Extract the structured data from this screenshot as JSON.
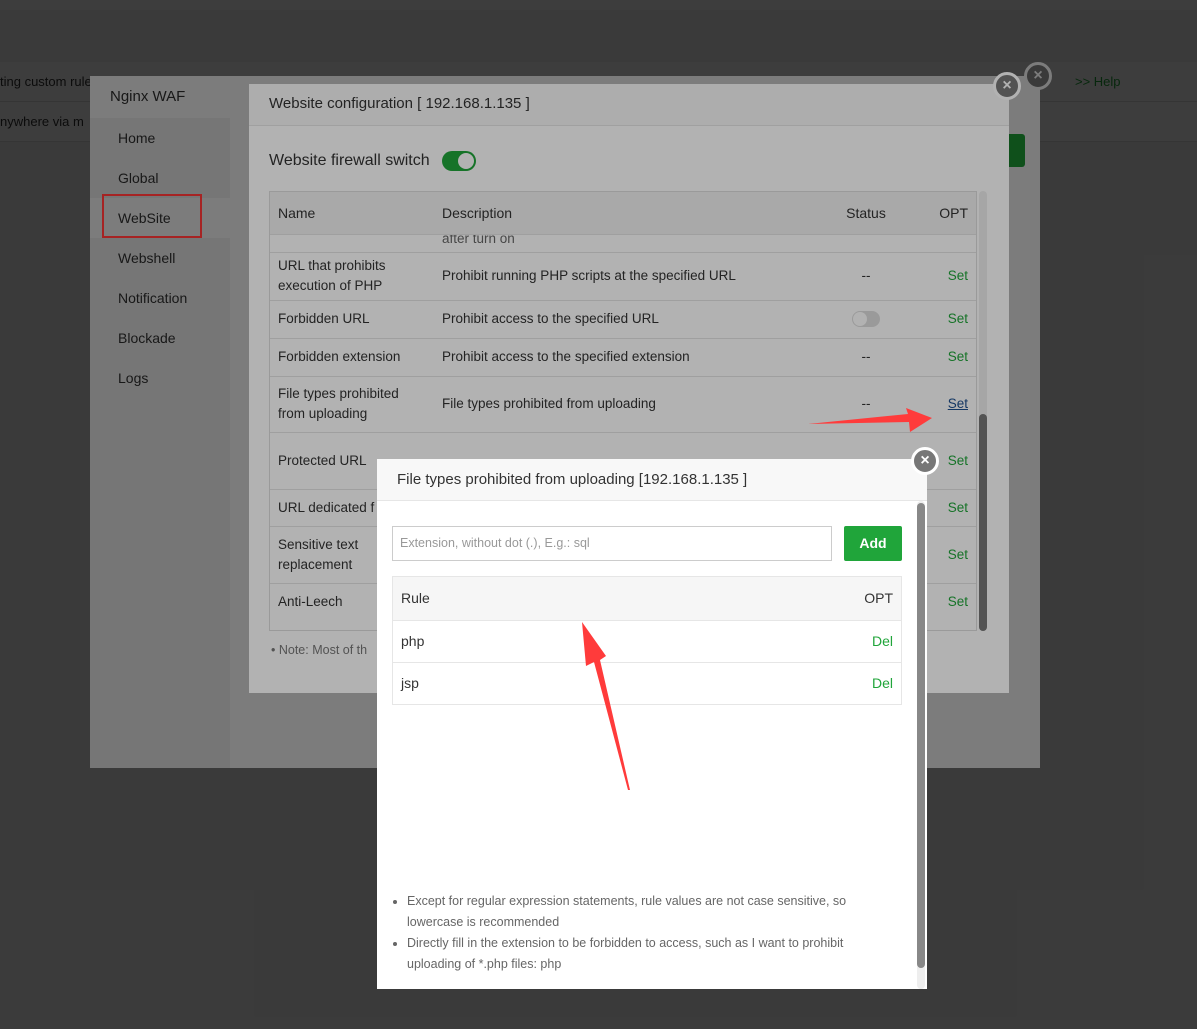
{
  "background": {
    "row1_text": "ting custom rule",
    "row1_help": ">> Help",
    "row2_text": "nywhere via m"
  },
  "waf": {
    "title": "Nginx WAF",
    "menu": [
      "Home",
      "Global",
      "WebSite",
      "Webshell",
      "Notification",
      "Blockade",
      "Logs"
    ],
    "active": "WebSite"
  },
  "config": {
    "title": "Website configuration [ 192.168.1.135 ]",
    "switch_label": "Website firewall switch",
    "switch_on": true,
    "columns": [
      "Name",
      "Description",
      "Status",
      "OPT"
    ],
    "rows": [
      {
        "name": "URL that prohibits execution of PHP",
        "desc": "Prohibit running PHP scripts at the specified URL",
        "status": "--",
        "opt": "Set"
      },
      {
        "name": "Forbidden URL",
        "desc": "Prohibit access to the specified URL",
        "status": "toggle-off",
        "opt": "Set"
      },
      {
        "name": "Forbidden extension",
        "desc": "Prohibit access to the specified extension",
        "status": "--",
        "opt": "Set"
      },
      {
        "name": "File types prohibited from uploading",
        "desc": "File types prohibited from uploading",
        "status": "--",
        "opt": "Set"
      },
      {
        "name": "Protected URL",
        "desc": "",
        "status": "",
        "opt": "Set"
      },
      {
        "name": "URL dedicated f",
        "desc": "",
        "status": "",
        "opt": "Set"
      },
      {
        "name": "Sensitive text replacement",
        "desc": "",
        "status": "",
        "opt": "Set"
      },
      {
        "name": "Anti-Leech",
        "desc": "",
        "status": "",
        "opt": "Set"
      }
    ],
    "partial_row": "after turn on",
    "note": "Note: Most of th"
  },
  "popup": {
    "title": "File types prohibited from uploading [192.168.1.135 ]",
    "placeholder": "Extension, without dot (.), E.g.: sql",
    "add": "Add",
    "columns": [
      "Rule",
      "OPT"
    ],
    "rules": [
      {
        "rule": "php",
        "opt": "Del"
      },
      {
        "rule": "jsp",
        "opt": "Del"
      }
    ],
    "notes": [
      "Except for regular expression statements, rule values are not case sensitive, so lowercase is recommended",
      "Directly fill in the extension to be forbidden to access, such as I want to prohibit uploading of *.php files: php"
    ]
  },
  "colors": {
    "accent": "#20a53a",
    "annotation": "#ff3b3b"
  }
}
